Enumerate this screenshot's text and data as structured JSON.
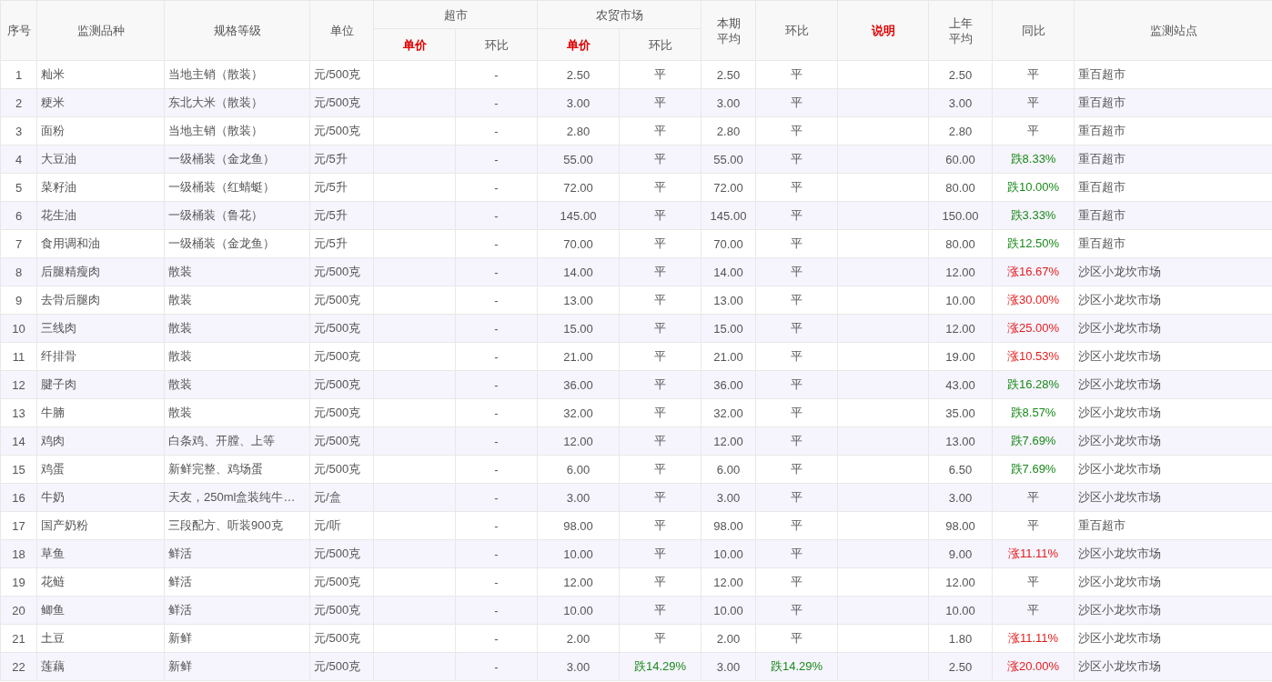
{
  "table": {
    "columns": [
      {
        "label": "序号",
        "highlight": false
      },
      {
        "label": "监测品种",
        "highlight": false
      },
      {
        "label": "规格等级",
        "highlight": false
      },
      {
        "label": "单位",
        "highlight": false
      },
      {
        "label": "超市",
        "highlight": false,
        "children": [
          {
            "label": "单价",
            "highlight": true
          },
          {
            "label": "环比",
            "highlight": false
          }
        ]
      },
      {
        "label": "农贸市场",
        "highlight": false,
        "children": [
          {
            "label": "单价",
            "highlight": true
          },
          {
            "label": "环比",
            "highlight": false
          }
        ]
      },
      {
        "label": "本期平均",
        "highlight": false
      },
      {
        "label": "环比",
        "highlight": false
      },
      {
        "label": "说明",
        "highlight": true
      },
      {
        "label": "上年平均",
        "highlight": false
      },
      {
        "label": "同比",
        "highlight": false
      },
      {
        "label": "监测站点",
        "highlight": false
      }
    ],
    "rows": [
      {
        "no": "1",
        "item": "籼米",
        "spec": "当地主销（散装）",
        "unit": "元/500克",
        "supermarket_change": "-",
        "market_price": "2.50",
        "market_change": {
          "text": "平",
          "kind": "flat"
        },
        "avg": "2.50",
        "avg_change": {
          "text": "平",
          "kind": "flat"
        },
        "last_year_avg": "2.50",
        "yoy": {
          "text": "平",
          "kind": "flat"
        },
        "station": "重百超市"
      },
      {
        "no": "2",
        "item": "粳米",
        "spec": "东北大米（散装）",
        "unit": "元/500克",
        "supermarket_change": "-",
        "market_price": "3.00",
        "market_change": {
          "text": "平",
          "kind": "flat"
        },
        "avg": "3.00",
        "avg_change": {
          "text": "平",
          "kind": "flat"
        },
        "last_year_avg": "3.00",
        "yoy": {
          "text": "平",
          "kind": "flat"
        },
        "station": "重百超市"
      },
      {
        "no": "3",
        "item": "面粉",
        "spec": "当地主销（散装）",
        "unit": "元/500克",
        "supermarket_change": "-",
        "market_price": "2.80",
        "market_change": {
          "text": "平",
          "kind": "flat"
        },
        "avg": "2.80",
        "avg_change": {
          "text": "平",
          "kind": "flat"
        },
        "last_year_avg": "2.80",
        "yoy": {
          "text": "平",
          "kind": "flat"
        },
        "station": "重百超市"
      },
      {
        "no": "4",
        "item": "大豆油",
        "spec": "一级桶装（金龙鱼）",
        "unit": "元/5升",
        "supermarket_change": "-",
        "market_price": "55.00",
        "market_change": {
          "text": "平",
          "kind": "flat"
        },
        "avg": "55.00",
        "avg_change": {
          "text": "平",
          "kind": "flat"
        },
        "last_year_avg": "60.00",
        "yoy": {
          "text": "跌8.33%",
          "kind": "down"
        },
        "station": "重百超市"
      },
      {
        "no": "5",
        "item": "菜籽油",
        "spec": "一级桶装（红蜻蜓）",
        "unit": "元/5升",
        "supermarket_change": "-",
        "market_price": "72.00",
        "market_change": {
          "text": "平",
          "kind": "flat"
        },
        "avg": "72.00",
        "avg_change": {
          "text": "平",
          "kind": "flat"
        },
        "last_year_avg": "80.00",
        "yoy": {
          "text": "跌10.00%",
          "kind": "down"
        },
        "station": "重百超市"
      },
      {
        "no": "6",
        "item": "花生油",
        "spec": "一级桶装（鲁花）",
        "unit": "元/5升",
        "supermarket_change": "-",
        "market_price": "145.00",
        "market_change": {
          "text": "平",
          "kind": "flat"
        },
        "avg": "145.00",
        "avg_change": {
          "text": "平",
          "kind": "flat"
        },
        "last_year_avg": "150.00",
        "yoy": {
          "text": "跌3.33%",
          "kind": "down"
        },
        "station": "重百超市"
      },
      {
        "no": "7",
        "item": "食用调和油",
        "spec": "一级桶装（金龙鱼）",
        "unit": "元/5升",
        "supermarket_change": "-",
        "market_price": "70.00",
        "market_change": {
          "text": "平",
          "kind": "flat"
        },
        "avg": "70.00",
        "avg_change": {
          "text": "平",
          "kind": "flat"
        },
        "last_year_avg": "80.00",
        "yoy": {
          "text": "跌12.50%",
          "kind": "down"
        },
        "station": "重百超市"
      },
      {
        "no": "8",
        "item": "后腿精瘦肉",
        "spec": "散装",
        "unit": "元/500克",
        "supermarket_change": "-",
        "market_price": "14.00",
        "market_change": {
          "text": "平",
          "kind": "flat"
        },
        "avg": "14.00",
        "avg_change": {
          "text": "平",
          "kind": "flat"
        },
        "last_year_avg": "12.00",
        "yoy": {
          "text": "涨16.67%",
          "kind": "up"
        },
        "station": "沙区小龙坎市场"
      },
      {
        "no": "9",
        "item": "去骨后腿肉",
        "spec": "散装",
        "unit": "元/500克",
        "supermarket_change": "-",
        "market_price": "13.00",
        "market_change": {
          "text": "平",
          "kind": "flat"
        },
        "avg": "13.00",
        "avg_change": {
          "text": "平",
          "kind": "flat"
        },
        "last_year_avg": "10.00",
        "yoy": {
          "text": "涨30.00%",
          "kind": "up"
        },
        "station": "沙区小龙坎市场"
      },
      {
        "no": "10",
        "item": "三线肉",
        "spec": "散装",
        "unit": "元/500克",
        "supermarket_change": "-",
        "market_price": "15.00",
        "market_change": {
          "text": "平",
          "kind": "flat"
        },
        "avg": "15.00",
        "avg_change": {
          "text": "平",
          "kind": "flat"
        },
        "last_year_avg": "12.00",
        "yoy": {
          "text": "涨25.00%",
          "kind": "up"
        },
        "station": "沙区小龙坎市场"
      },
      {
        "no": "11",
        "item": "纤排骨",
        "spec": "散装",
        "unit": "元/500克",
        "supermarket_change": "-",
        "market_price": "21.00",
        "market_change": {
          "text": "平",
          "kind": "flat"
        },
        "avg": "21.00",
        "avg_change": {
          "text": "平",
          "kind": "flat"
        },
        "last_year_avg": "19.00",
        "yoy": {
          "text": "涨10.53%",
          "kind": "up"
        },
        "station": "沙区小龙坎市场"
      },
      {
        "no": "12",
        "item": "腱子肉",
        "spec": "散装",
        "unit": "元/500克",
        "supermarket_change": "-",
        "market_price": "36.00",
        "market_change": {
          "text": "平",
          "kind": "flat"
        },
        "avg": "36.00",
        "avg_change": {
          "text": "平",
          "kind": "flat"
        },
        "last_year_avg": "43.00",
        "yoy": {
          "text": "跌16.28%",
          "kind": "down"
        },
        "station": "沙区小龙坎市场"
      },
      {
        "no": "13",
        "item": "牛腩",
        "spec": "散装",
        "unit": "元/500克",
        "supermarket_change": "-",
        "market_price": "32.00",
        "market_change": {
          "text": "平",
          "kind": "flat"
        },
        "avg": "32.00",
        "avg_change": {
          "text": "平",
          "kind": "flat"
        },
        "last_year_avg": "35.00",
        "yoy": {
          "text": "跌8.57%",
          "kind": "down"
        },
        "station": "沙区小龙坎市场"
      },
      {
        "no": "14",
        "item": "鸡肉",
        "spec": "白条鸡、开膛、上等",
        "unit": "元/500克",
        "supermarket_change": "-",
        "market_price": "12.00",
        "market_change": {
          "text": "平",
          "kind": "flat"
        },
        "avg": "12.00",
        "avg_change": {
          "text": "平",
          "kind": "flat"
        },
        "last_year_avg": "13.00",
        "yoy": {
          "text": "跌7.69%",
          "kind": "down"
        },
        "station": "沙区小龙坎市场"
      },
      {
        "no": "15",
        "item": "鸡蛋",
        "spec": "新鲜完整、鸡场蛋",
        "unit": "元/500克",
        "supermarket_change": "-",
        "market_price": "6.00",
        "market_change": {
          "text": "平",
          "kind": "flat"
        },
        "avg": "6.00",
        "avg_change": {
          "text": "平",
          "kind": "flat"
        },
        "last_year_avg": "6.50",
        "yoy": {
          "text": "跌7.69%",
          "kind": "down"
        },
        "station": "沙区小龙坎市场"
      },
      {
        "no": "16",
        "item": "牛奶",
        "spec": "天友，250ml盒装纯牛…",
        "unit": "元/盒",
        "supermarket_change": "-",
        "market_price": "3.00",
        "market_change": {
          "text": "平",
          "kind": "flat"
        },
        "avg": "3.00",
        "avg_change": {
          "text": "平",
          "kind": "flat"
        },
        "last_year_avg": "3.00",
        "yoy": {
          "text": "平",
          "kind": "flat"
        },
        "station": "沙区小龙坎市场"
      },
      {
        "no": "17",
        "item": "国产奶粉",
        "spec": "三段配方、听装900克",
        "unit": "元/听",
        "supermarket_change": "-",
        "market_price": "98.00",
        "market_change": {
          "text": "平",
          "kind": "flat"
        },
        "avg": "98.00",
        "avg_change": {
          "text": "平",
          "kind": "flat"
        },
        "last_year_avg": "98.00",
        "yoy": {
          "text": "平",
          "kind": "flat"
        },
        "station": "重百超市"
      },
      {
        "no": "18",
        "item": "草鱼",
        "spec": "鲜活",
        "unit": "元/500克",
        "supermarket_change": "-",
        "market_price": "10.00",
        "market_change": {
          "text": "平",
          "kind": "flat"
        },
        "avg": "10.00",
        "avg_change": {
          "text": "平",
          "kind": "flat"
        },
        "last_year_avg": "9.00",
        "yoy": {
          "text": "涨11.11%",
          "kind": "up"
        },
        "station": "沙区小龙坎市场"
      },
      {
        "no": "19",
        "item": "花鲢",
        "spec": "鲜活",
        "unit": "元/500克",
        "supermarket_change": "-",
        "market_price": "12.00",
        "market_change": {
          "text": "平",
          "kind": "flat"
        },
        "avg": "12.00",
        "avg_change": {
          "text": "平",
          "kind": "flat"
        },
        "last_year_avg": "12.00",
        "yoy": {
          "text": "平",
          "kind": "flat"
        },
        "station": "沙区小龙坎市场"
      },
      {
        "no": "20",
        "item": "鲫鱼",
        "spec": "鲜活",
        "unit": "元/500克",
        "supermarket_change": "-",
        "market_price": "10.00",
        "market_change": {
          "text": "平",
          "kind": "flat"
        },
        "avg": "10.00",
        "avg_change": {
          "text": "平",
          "kind": "flat"
        },
        "last_year_avg": "10.00",
        "yoy": {
          "text": "平",
          "kind": "flat"
        },
        "station": "沙区小龙坎市场"
      },
      {
        "no": "21",
        "item": "土豆",
        "spec": "新鲜",
        "unit": "元/500克",
        "supermarket_change": "-",
        "market_price": "2.00",
        "market_change": {
          "text": "平",
          "kind": "flat"
        },
        "avg": "2.00",
        "avg_change": {
          "text": "平",
          "kind": "flat"
        },
        "last_year_avg": "1.80",
        "yoy": {
          "text": "涨11.11%",
          "kind": "up"
        },
        "station": "沙区小龙坎市场"
      },
      {
        "no": "22",
        "item": "莲藕",
        "spec": "新鲜",
        "unit": "元/500克",
        "supermarket_change": "-",
        "market_price": "3.00",
        "market_change": {
          "text": "跌14.29%",
          "kind": "down"
        },
        "avg": "3.00",
        "avg_change": {
          "text": "跌14.29%",
          "kind": "down"
        },
        "last_year_avg": "2.50",
        "yoy": {
          "text": "涨20.00%",
          "kind": "up"
        },
        "station": "沙区小龙坎市场"
      }
    ]
  }
}
